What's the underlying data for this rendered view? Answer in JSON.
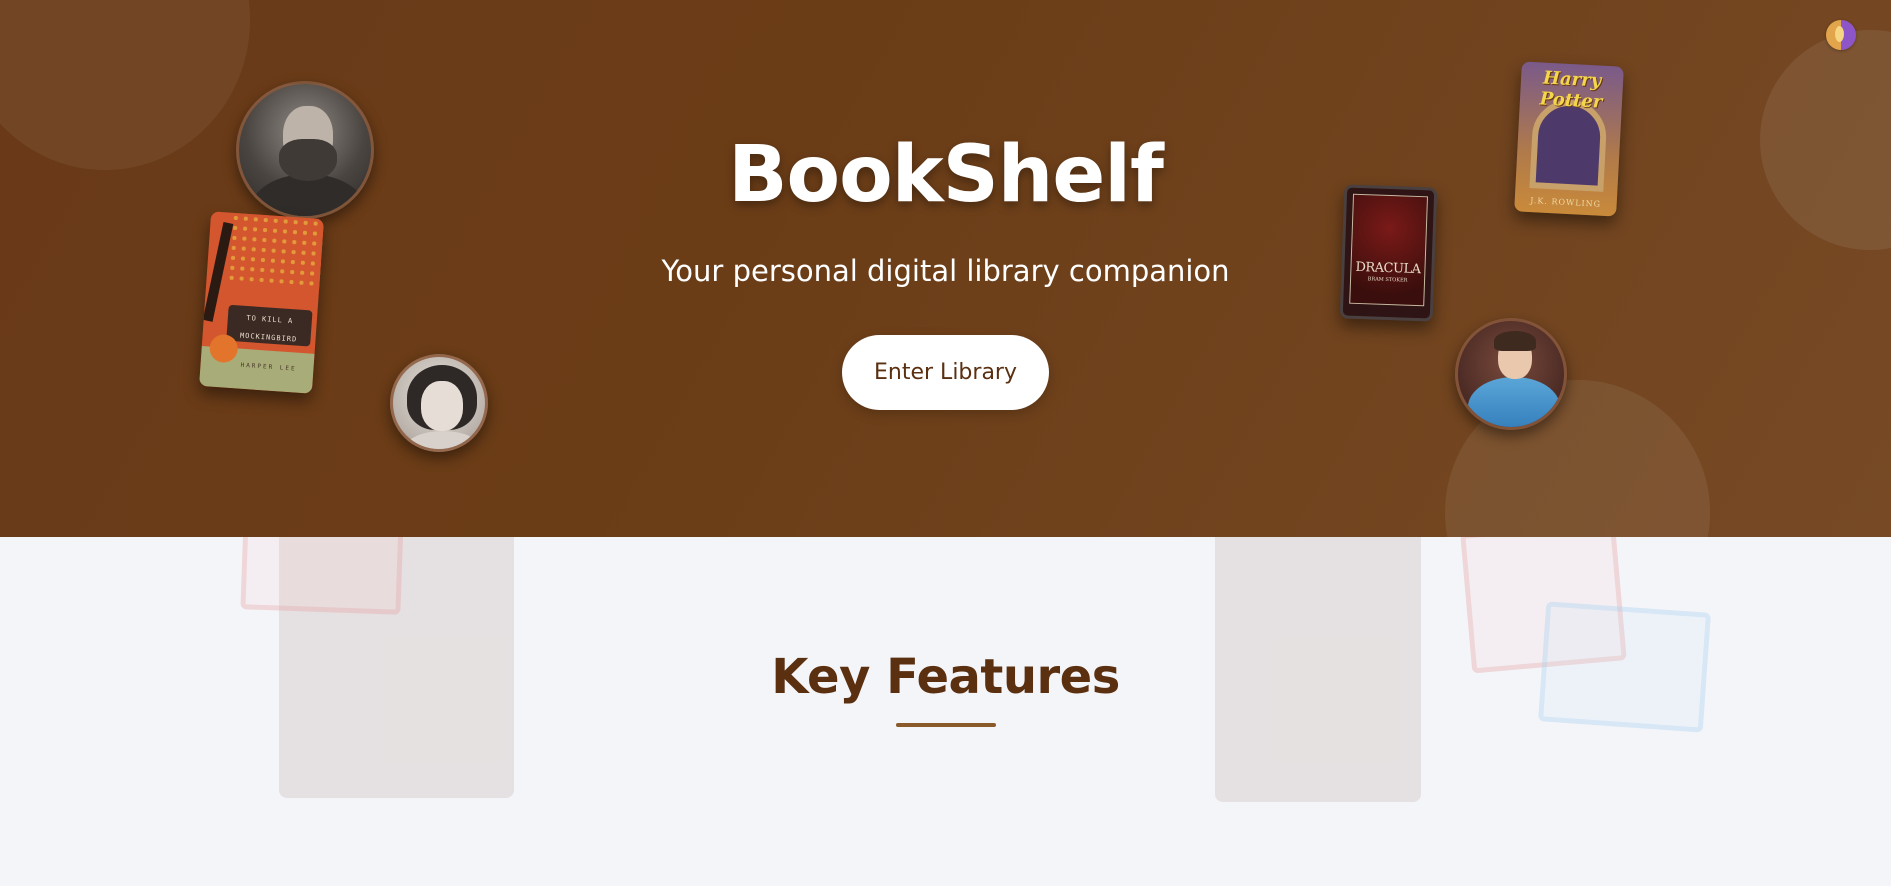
{
  "hero": {
    "title": "BookShelf",
    "subtitle": "Your personal digital library companion",
    "cta_label": "Enter Library"
  },
  "books": {
    "mockingbird": {
      "title_line1": "TO KILL A",
      "title_line2": "MOCKINGBIRD",
      "author": "HARPER LEE"
    },
    "dracula": {
      "title": "DRACULA",
      "author": "BRAM STOKER"
    },
    "harry_potter": {
      "title": "Harry Potter",
      "author": "J.K. ROWLING"
    }
  },
  "features": {
    "title": "Key Features"
  },
  "colors": {
    "brand_brown": "#6b3d17",
    "heading_brown": "#5b3011",
    "underline": "#8b5a2b",
    "page_bg": "#f4f5f9"
  }
}
